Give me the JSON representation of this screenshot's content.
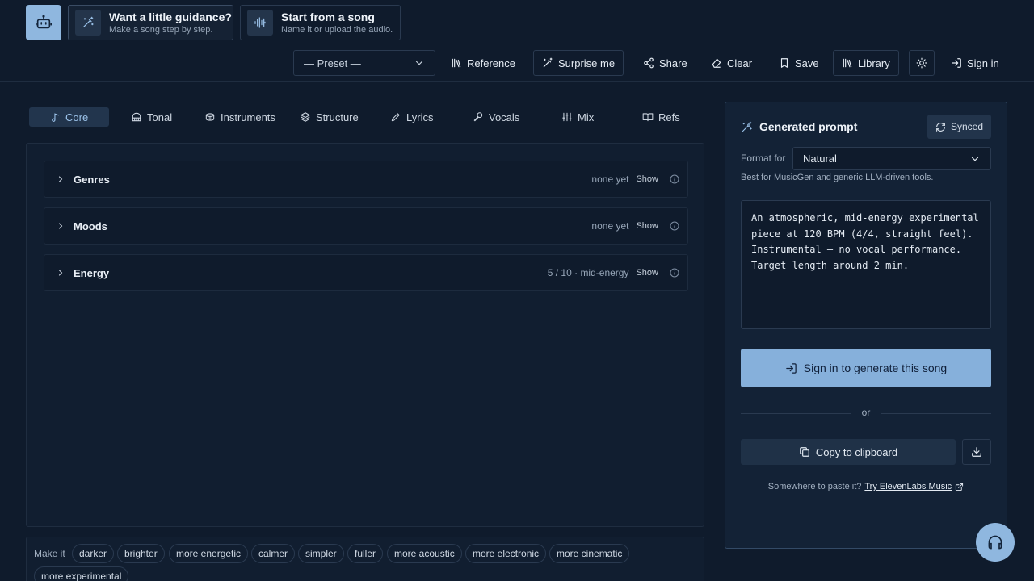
{
  "hero": {
    "guidance_title": "Want a little guidance?",
    "guidance_sub": "Make a song step by step.",
    "song_title": "Start from a song",
    "song_sub": "Name it or upload the audio."
  },
  "toolbar": {
    "preset": "— Preset —",
    "reference": "Reference",
    "surprise": "Surprise me",
    "share": "Share",
    "clear": "Clear",
    "save": "Save",
    "library": "Library",
    "signin": "Sign in"
  },
  "tabs": [
    {
      "label": "Core",
      "icon": "music-note-icon"
    },
    {
      "label": "Tonal",
      "icon": "piano-icon"
    },
    {
      "label": "Instruments",
      "icon": "drum-icon"
    },
    {
      "label": "Structure",
      "icon": "layers-icon"
    },
    {
      "label": "Lyrics",
      "icon": "pencil-icon"
    },
    {
      "label": "Vocals",
      "icon": "microphone-icon"
    },
    {
      "label": "Mix",
      "icon": "sliders-icon"
    },
    {
      "label": "Refs",
      "icon": "book-icon"
    }
  ],
  "sections": [
    {
      "title": "Genres",
      "summary": "none yet",
      "show": "Show"
    },
    {
      "title": "Moods",
      "summary": "none yet",
      "show": "Show"
    },
    {
      "title": "Energy",
      "summary": "5 / 10 · mid-energy",
      "show": "Show"
    }
  ],
  "modifiers": {
    "label": "Make it",
    "chips": [
      "darker",
      "brighter",
      "more energetic",
      "calmer",
      "simpler",
      "fuller",
      "more acoustic",
      "more electronic",
      "more cinematic",
      "more experimental"
    ]
  },
  "generated": {
    "title": "Generated prompt",
    "synced": "Synced",
    "format_label": "Format for",
    "format_value": "Natural",
    "format_hint": "Best for MusicGen and generic LLM-driven tools.",
    "prompt": "An atmospheric, mid-energy experimental\npiece at 120 BPM (4/4, straight feel).\nInstrumental — no vocal performance.\nTarget length around 2 min.",
    "generate_button": "Sign in to generate this song",
    "or": "or",
    "copy_button": "Copy to clipboard",
    "paste_text": "Somewhere to paste it?",
    "paste_link": "Try ElevenLabs Music"
  },
  "colors": {
    "background": "#0f1b2c",
    "accent": "#86b0db",
    "active_tab": "#9cc3ea"
  }
}
